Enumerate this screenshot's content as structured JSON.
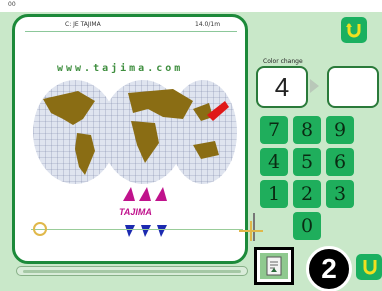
{
  "topbar": {
    "tag": "00"
  },
  "design": {
    "name": "C: JE TAJIMA",
    "size": "14.0/1m",
    "url_text": "www.tajima.com",
    "brand_text": "TAJIMA"
  },
  "color_change": {
    "label": "Color change",
    "current_value": "4",
    "next_value": ""
  },
  "keypad": {
    "keys": [
      "7",
      "8",
      "9",
      "4",
      "5",
      "6",
      "1",
      "2",
      "3",
      "0"
    ]
  },
  "callout": {
    "number": "2"
  },
  "icons": {
    "undo": "u-turn-arrow-icon",
    "ok": "ok-icon",
    "document": "document-icon",
    "target": "target-circle-icon",
    "crosshair": "crosshair-icon"
  },
  "colors": {
    "panel_border": "#1c8a3a",
    "key_green": "#1fae5c",
    "background": "#c9e8c9"
  }
}
